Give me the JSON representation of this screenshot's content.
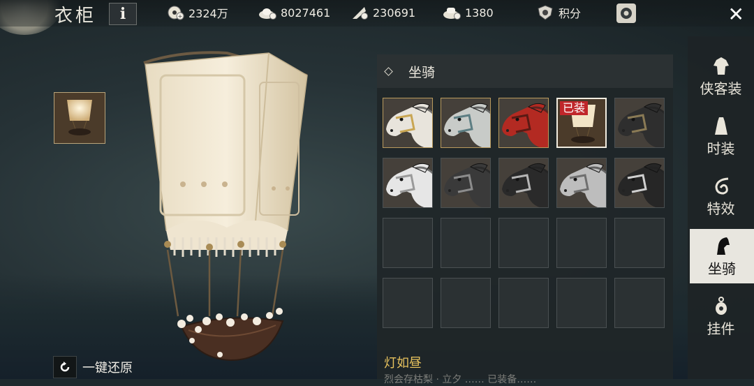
{
  "window": {
    "title": "衣柜",
    "info_label": "i"
  },
  "currencies": [
    {
      "icon": "coin-icon",
      "value": "2324万"
    },
    {
      "icon": "silver-ingot-icon",
      "value": "8027461"
    },
    {
      "icon": "feather-token-icon",
      "value": "230691"
    },
    {
      "icon": "gold-ingot-icon",
      "value": "1380"
    }
  ],
  "points": {
    "label": "积分"
  },
  "panel": {
    "category": "坐骑",
    "equipped_tag": "已装",
    "selected_name": "灯如昼",
    "selected_desc": "烈会存枯梨 · 立夕 ……    已装备……"
  },
  "grid_items": [
    {
      "name": "mount-white-gold-horse",
      "type": "horse",
      "coat": "#e8e4dc",
      "tack": "#c9a653",
      "rarity": "gold"
    },
    {
      "name": "mount-grey-armored-horse",
      "type": "horse",
      "coat": "#c8cbc8",
      "tack": "#5d7e83",
      "rarity": "gold"
    },
    {
      "name": "mount-red-horse",
      "type": "horse",
      "coat": "#b32a22",
      "tack": "#5a1a14",
      "rarity": "gold"
    },
    {
      "name": "mount-lantern-balloon",
      "type": "lantern",
      "rarity": "gold",
      "selected": true,
      "equipped": true
    },
    {
      "name": "mount-black-horse",
      "type": "horse",
      "coat": "#2e2e2e",
      "tack": "#8a7a55",
      "rarity": "normal"
    },
    {
      "name": "mount-white-horse",
      "type": "horse",
      "coat": "#e6e6e6",
      "tack": "#9a9a9a",
      "rarity": "normal"
    },
    {
      "name": "mount-dark-armored-horse",
      "type": "horse",
      "coat": "#3a3a3a",
      "tack": "#8c8c8c",
      "rarity": "normal"
    },
    {
      "name": "mount-black-plated-horse",
      "type": "horse",
      "coat": "#2a2a2a",
      "tack": "#b5b5b5",
      "rarity": "normal"
    },
    {
      "name": "mount-grey-bridled-horse",
      "type": "horse",
      "coat": "#bdbdbd",
      "tack": "#6f6f6f",
      "rarity": "normal"
    },
    {
      "name": "mount-black-bridled-horse",
      "type": "horse",
      "coat": "#262626",
      "tack": "#cfcfcf",
      "rarity": "normal"
    },
    {
      "type": "empty"
    },
    {
      "type": "empty"
    },
    {
      "type": "empty"
    },
    {
      "type": "empty"
    },
    {
      "type": "empty"
    },
    {
      "type": "empty"
    },
    {
      "type": "empty"
    },
    {
      "type": "empty"
    },
    {
      "type": "empty"
    },
    {
      "type": "empty"
    }
  ],
  "sidebar": {
    "items": [
      {
        "label": "侠客装",
        "icon": "robe-icon",
        "active": false
      },
      {
        "label": "时装",
        "icon": "fashion-icon",
        "active": false
      },
      {
        "label": "特效",
        "icon": "effect-swirl-icon",
        "active": false
      },
      {
        "label": "坐骑",
        "icon": "horse-head-icon",
        "active": true
      },
      {
        "label": "挂件",
        "icon": "pendant-icon",
        "active": false
      }
    ]
  },
  "reset": {
    "label": "一键还原"
  },
  "colors": {
    "equipped_tag": "#c0262a",
    "item_name": "#e6c15d",
    "active_tab_bg": "#e8e6df"
  }
}
